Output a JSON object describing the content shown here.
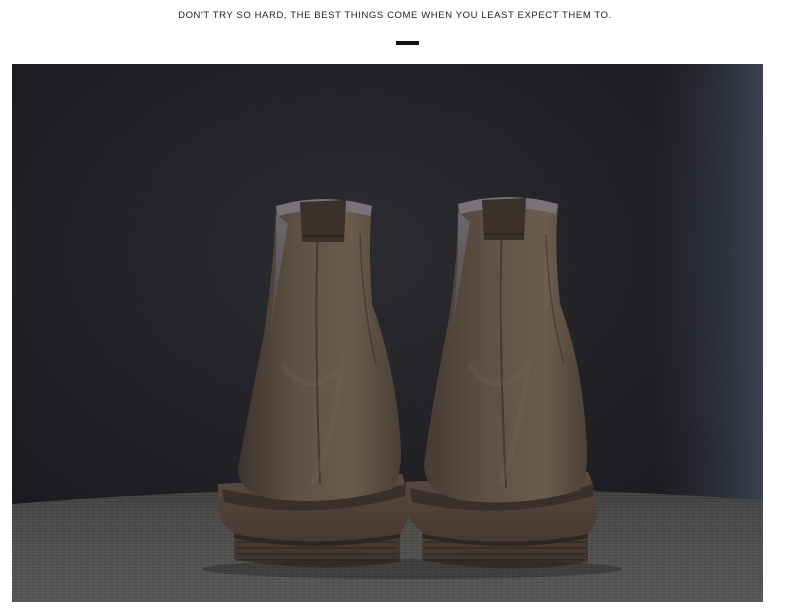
{
  "header": {
    "tagline": "DON'T TRY SO HARD, THE BEST THINGS COME WHEN YOU LEAST EXPECT THEM TO."
  },
  "photo": {
    "subject": "boot",
    "colors": {
      "backdrop": "#1e1f22",
      "suede": "#5a4c3f",
      "sole": "#4a3d33",
      "surface": "#4a4a48"
    }
  }
}
